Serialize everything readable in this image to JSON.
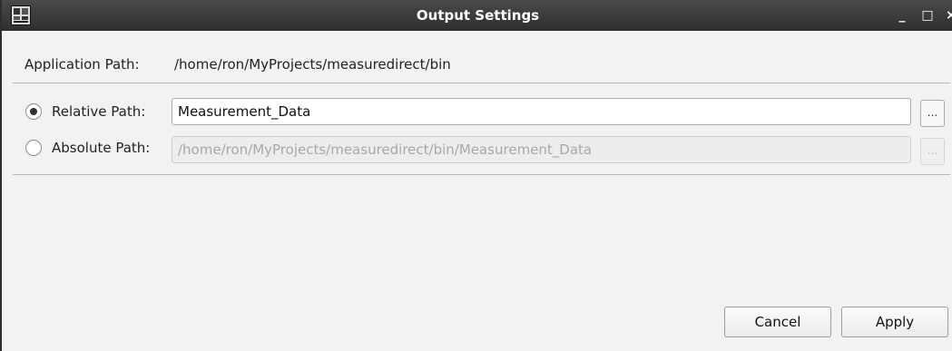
{
  "window": {
    "title": "Output Settings",
    "minimize_glyph": "_",
    "maximize_glyph": "□",
    "close_glyph": "×"
  },
  "application_path": {
    "label": "Application Path:",
    "value": "/home/ron/MyProjects/measuredirect/bin"
  },
  "relative_path": {
    "label": "Relative Path:",
    "value": "Measurement_Data",
    "selected": true,
    "browse_label": "..."
  },
  "absolute_path": {
    "label": "Absolute Path:",
    "value": "/home/ron/MyProjects/measuredirect/bin/Measurement_Data",
    "selected": false,
    "enabled": false,
    "browse_label": "..."
  },
  "buttons": {
    "cancel": "Cancel",
    "apply": "Apply"
  },
  "icons": {
    "app_icon": "app-icon",
    "radio_selected": "radio-checked-icon",
    "radio_unselected": "radio-unchecked-icon"
  },
  "colors": {
    "titlebar": "#3a3a3a",
    "dialog_background": "#f2f2f2",
    "disabled_text": "#a8a8a8"
  }
}
